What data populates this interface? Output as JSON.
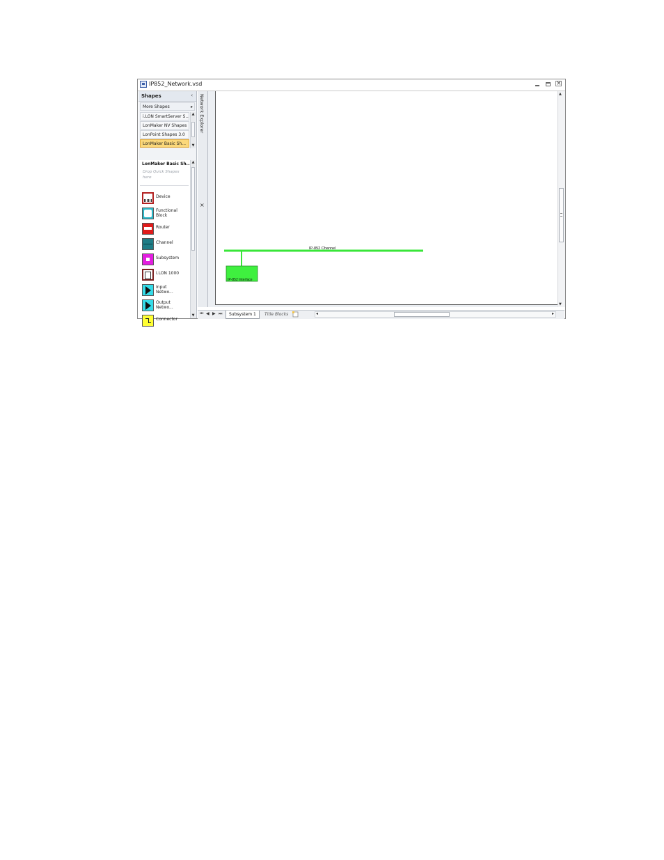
{
  "window": {
    "title": "IP852_Network.vsd",
    "minimize_icon": "minimize-icon",
    "restore_icon": "restore-icon",
    "close_icon": "close-icon"
  },
  "shapes_pane": {
    "header": "Shapes",
    "collapse_glyph": "‹",
    "more_shapes": "More Shapes",
    "more_arrow": "▸",
    "stencils": [
      "i.LON SmartServer S...",
      "LonMaker NV Shapes",
      "LonPoint Shapes 3.0",
      "LonMaker Basic Sh..."
    ],
    "active_stencil_title": "LonMaker Basic Sh...",
    "quick_shapes_hint": "Drop Quick Shapes here",
    "masters": [
      {
        "name": "Device",
        "icon": "device-icon"
      },
      {
        "name": "Functional Block",
        "icon": "functional-block-icon"
      },
      {
        "name": "Router",
        "icon": "router-icon"
      },
      {
        "name": "Channel",
        "icon": "channel-icon"
      },
      {
        "name": "Subsystem",
        "icon": "subsystem-icon"
      },
      {
        "name": "i.LON 1000",
        "icon": "ilon-1000-icon"
      },
      {
        "name": "Input Netwo...",
        "icon": "input-network-icon"
      },
      {
        "name": "Output Netwo...",
        "icon": "output-network-icon"
      },
      {
        "name": "Connector",
        "icon": "connector-icon"
      }
    ]
  },
  "network_explorer": {
    "title": "Network Explorer",
    "close_glyph": "×"
  },
  "drawing": {
    "channel_label": "IP-852 Channel",
    "device_label": "IP-852 Interface",
    "channel_color": "#39e639",
    "device_color": "#3ff03f"
  },
  "tabs": {
    "active": "Subsystem 1",
    "inactive": "Title Blocks"
  },
  "nav_glyphs": {
    "first": "⏮",
    "prev": "◀",
    "next": "▶",
    "last": "⏭"
  }
}
